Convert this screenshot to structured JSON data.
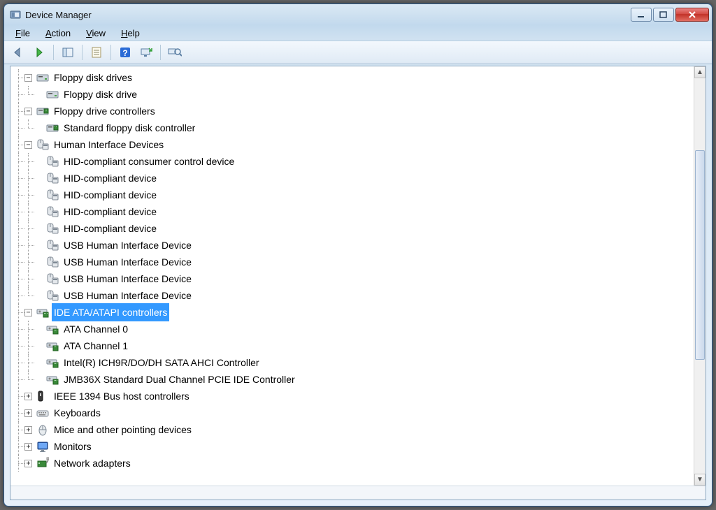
{
  "window": {
    "title": "Device Manager"
  },
  "menu": {
    "file": "File",
    "action": "Action",
    "view": "View",
    "help": "Help"
  },
  "toolbar_icons": {
    "back": "back-arrow",
    "forward": "forward-arrow",
    "show_hide": "show-hide-console-tree",
    "properties": "properties",
    "help": "help",
    "scan": "scan-hardware",
    "find": "find"
  },
  "tree": [
    {
      "id": "floppy_drives",
      "label": "Floppy disk drives",
      "level": 1,
      "expander": "minus",
      "icon": "floppy-drive",
      "selected": false
    },
    {
      "id": "floppy_drive_1",
      "label": "Floppy disk drive",
      "level": 2,
      "expander": "none",
      "icon": "floppy-drive",
      "selected": false,
      "last": true
    },
    {
      "id": "floppy_ctrl",
      "label": "Floppy drive controllers",
      "level": 1,
      "expander": "minus",
      "icon": "floppy-controller",
      "selected": false
    },
    {
      "id": "std_floppy_ctrl",
      "label": "Standard floppy disk controller",
      "level": 2,
      "expander": "none",
      "icon": "floppy-controller",
      "selected": false,
      "last": true
    },
    {
      "id": "hid",
      "label": "Human Interface Devices",
      "level": 1,
      "expander": "minus",
      "icon": "hid",
      "selected": false
    },
    {
      "id": "hid1",
      "label": "HID-compliant consumer control device",
      "level": 2,
      "expander": "none",
      "icon": "hid",
      "selected": false
    },
    {
      "id": "hid2",
      "label": "HID-compliant device",
      "level": 2,
      "expander": "none",
      "icon": "hid",
      "selected": false
    },
    {
      "id": "hid3",
      "label": "HID-compliant device",
      "level": 2,
      "expander": "none",
      "icon": "hid",
      "selected": false
    },
    {
      "id": "hid4",
      "label": "HID-compliant device",
      "level": 2,
      "expander": "none",
      "icon": "hid",
      "selected": false
    },
    {
      "id": "hid5",
      "label": "HID-compliant device",
      "level": 2,
      "expander": "none",
      "icon": "hid",
      "selected": false
    },
    {
      "id": "usbhid1",
      "label": "USB Human Interface Device",
      "level": 2,
      "expander": "none",
      "icon": "hid",
      "selected": false
    },
    {
      "id": "usbhid2",
      "label": "USB Human Interface Device",
      "level": 2,
      "expander": "none",
      "icon": "hid",
      "selected": false
    },
    {
      "id": "usbhid3",
      "label": "USB Human Interface Device",
      "level": 2,
      "expander": "none",
      "icon": "hid",
      "selected": false
    },
    {
      "id": "usbhid4",
      "label": "USB Human Interface Device",
      "level": 2,
      "expander": "none",
      "icon": "hid",
      "selected": false,
      "last": true
    },
    {
      "id": "ide",
      "label": "IDE ATA/ATAPI controllers",
      "level": 1,
      "expander": "minus",
      "icon": "storage-ctrl",
      "selected": true
    },
    {
      "id": "ata0",
      "label": "ATA Channel 0",
      "level": 2,
      "expander": "none",
      "icon": "storage-ctrl",
      "selected": false
    },
    {
      "id": "ata1",
      "label": "ATA Channel 1",
      "level": 2,
      "expander": "none",
      "icon": "storage-ctrl",
      "selected": false
    },
    {
      "id": "ich9r",
      "label": "Intel(R) ICH9R/DO/DH SATA AHCI Controller",
      "level": 2,
      "expander": "none",
      "icon": "storage-ctrl",
      "selected": false
    },
    {
      "id": "jmb36x",
      "label": "JMB36X Standard Dual Channel PCIE IDE Controller",
      "level": 2,
      "expander": "none",
      "icon": "storage-ctrl",
      "selected": false,
      "last": true
    },
    {
      "id": "ieee1394",
      "label": "IEEE 1394 Bus host controllers",
      "level": 1,
      "expander": "plus",
      "icon": "1394",
      "selected": false
    },
    {
      "id": "keyboards",
      "label": "Keyboards",
      "level": 1,
      "expander": "plus",
      "icon": "keyboard",
      "selected": false
    },
    {
      "id": "mice",
      "label": "Mice and other pointing devices",
      "level": 1,
      "expander": "plus",
      "icon": "mouse",
      "selected": false
    },
    {
      "id": "monitors",
      "label": "Monitors",
      "level": 1,
      "expander": "plus",
      "icon": "monitor",
      "selected": false
    },
    {
      "id": "network",
      "label": "Network adapters",
      "level": 1,
      "expander": "plus",
      "icon": "network",
      "selected": false
    }
  ]
}
